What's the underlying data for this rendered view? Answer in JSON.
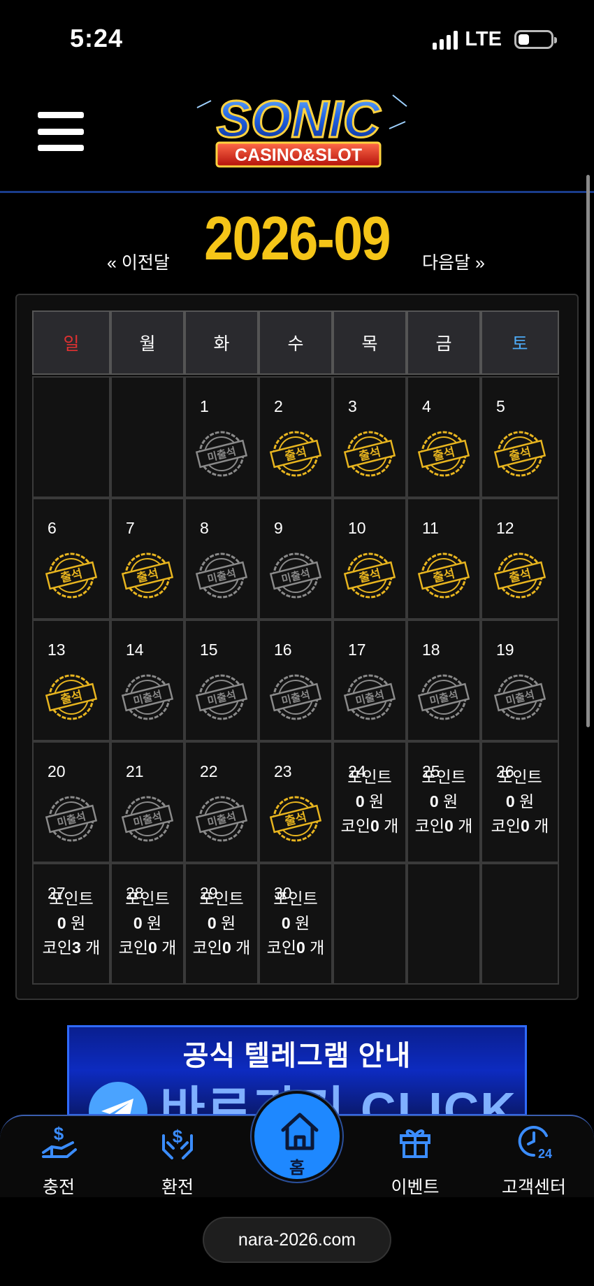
{
  "status": {
    "time": "5:24",
    "network": "LTE",
    "battery_fraction": 0.3
  },
  "header": {
    "logo_top": "SONIC",
    "logo_bottom": "CASINO&SLOT"
  },
  "month_nav": {
    "prev": "« 이전달",
    "title": "2026-09",
    "next": "다음달 »"
  },
  "weekdays": [
    "일",
    "월",
    "화",
    "수",
    "목",
    "금",
    "토"
  ],
  "weekday_colors": {
    "sun": "#e03131",
    "sat": "#4dabf7",
    "default": "#ffffff"
  },
  "stamp_labels": {
    "attended": "출석",
    "absent": "미출석"
  },
  "stats_labels": {
    "point": "포인트",
    "won": "원",
    "coin": "코인",
    "count": "개"
  },
  "calendar": [
    [
      {
        "day": ""
      },
      {
        "day": ""
      },
      {
        "day": "1",
        "stamp": "absent"
      },
      {
        "day": "2",
        "stamp": "attended"
      },
      {
        "day": "3",
        "stamp": "attended"
      },
      {
        "day": "4",
        "stamp": "attended"
      },
      {
        "day": "5",
        "stamp": "attended"
      }
    ],
    [
      {
        "day": "6",
        "stamp": "attended"
      },
      {
        "day": "7",
        "stamp": "attended"
      },
      {
        "day": "8",
        "stamp": "absent"
      },
      {
        "day": "9",
        "stamp": "absent"
      },
      {
        "day": "10",
        "stamp": "attended"
      },
      {
        "day": "11",
        "stamp": "attended"
      },
      {
        "day": "12",
        "stamp": "attended"
      }
    ],
    [
      {
        "day": "13",
        "stamp": "attended"
      },
      {
        "day": "14",
        "stamp": "absent"
      },
      {
        "day": "15",
        "stamp": "absent"
      },
      {
        "day": "16",
        "stamp": "absent"
      },
      {
        "day": "17",
        "stamp": "absent"
      },
      {
        "day": "18",
        "stamp": "absent"
      },
      {
        "day": "19",
        "stamp": "absent"
      }
    ],
    [
      {
        "day": "20",
        "stamp": "absent"
      },
      {
        "day": "21",
        "stamp": "absent"
      },
      {
        "day": "22",
        "stamp": "absent"
      },
      {
        "day": "23",
        "stamp": "attended"
      },
      {
        "day": "24",
        "point": "0",
        "coin": "0"
      },
      {
        "day": "25",
        "point": "0",
        "coin": "0"
      },
      {
        "day": "26",
        "point": "0",
        "coin": "0"
      }
    ],
    [
      {
        "day": "27",
        "point": "0",
        "coin": "3"
      },
      {
        "day": "28",
        "point": "0",
        "coin": "0"
      },
      {
        "day": "29",
        "point": "0",
        "coin": "0"
      },
      {
        "day": "30",
        "point": "0",
        "coin": "0"
      },
      {
        "day": ""
      },
      {
        "day": ""
      },
      {
        "day": ""
      }
    ]
  ],
  "banner": {
    "title": "공식 텔레그램 안내",
    "cta": "바로가기 CLICK"
  },
  "bottom_nav": [
    {
      "label": "충전",
      "icon": "deposit-icon"
    },
    {
      "label": "환전",
      "icon": "withdraw-icon"
    },
    {
      "label": "홈",
      "icon": "home-icon"
    },
    {
      "label": "이벤트",
      "icon": "gift-icon"
    },
    {
      "label": "고객센터",
      "icon": "support-24-icon"
    }
  ],
  "url": "nara-2026.com"
}
